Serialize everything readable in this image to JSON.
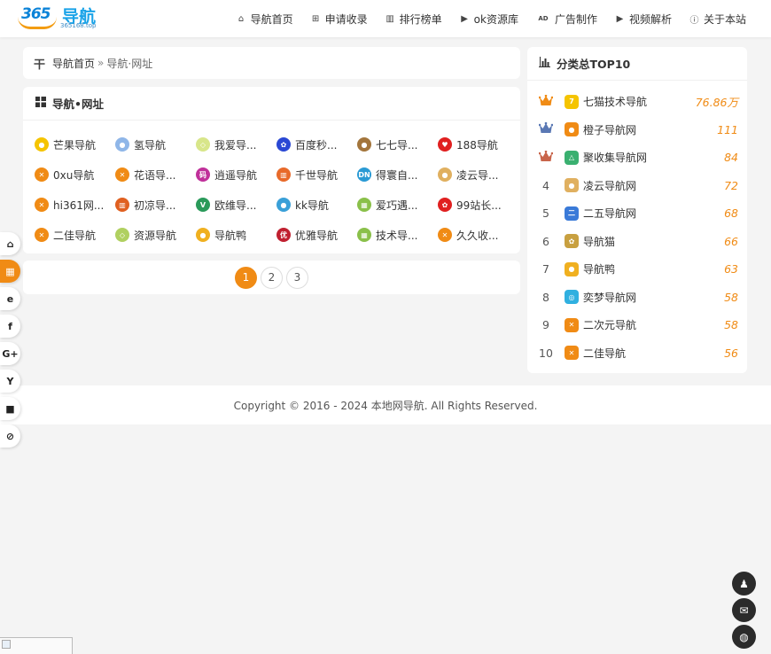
{
  "header": {
    "logo": {
      "main": "365",
      "sub": "导航",
      "domain": "365168.top"
    },
    "nav": [
      {
        "label": "导航首页",
        "icon": "home-icon"
      },
      {
        "label": "申请收录",
        "icon": "plus-square-icon"
      },
      {
        "label": "排行榜单",
        "icon": "bar-chart-icon"
      },
      {
        "label": "ok资源库",
        "icon": "play-square-icon"
      },
      {
        "label": "广告制作",
        "icon": "ad-icon",
        "icon_text": "AD"
      },
      {
        "label": "视频解析",
        "icon": "play-square-icon"
      },
      {
        "label": "关于本站",
        "icon": "info-circle-icon"
      }
    ]
  },
  "breadcrumb": {
    "home": "导航首页",
    "sep": "»",
    "current": "导航·网址"
  },
  "links_panel": {
    "title": "导航•网址",
    "items": [
      {
        "label": "芒果导航",
        "color": "#f5c400",
        "glyph": "●"
      },
      {
        "label": "氢导航",
        "color": "#8fb6e8",
        "glyph": "●"
      },
      {
        "label": "我爱导...",
        "color": "#d8e68a",
        "glyph": "◇"
      },
      {
        "label": "百度秒...",
        "color": "#2a48d4",
        "glyph": "✿"
      },
      {
        "label": "七七导...",
        "color": "#a3753c",
        "glyph": "●"
      },
      {
        "label": "188导航",
        "color": "#e02020",
        "glyph": "♥"
      },
      {
        "label": "0xu导航",
        "color": "#f08b15",
        "glyph": "✕"
      },
      {
        "label": "花语导...",
        "color": "#f08b15",
        "glyph": "✕"
      },
      {
        "label": "逍遥导航",
        "color": "#c0309a",
        "glyph": "码"
      },
      {
        "label": "千世导航",
        "color": "#e86a2a",
        "glyph": "▥"
      },
      {
        "label": "得寰自...",
        "color": "#2a9ad4",
        "glyph": "DN"
      },
      {
        "label": "凌云导...",
        "color": "#e0b060",
        "glyph": "●"
      },
      {
        "label": "hi361网...",
        "color": "#f08b15",
        "glyph": "✕"
      },
      {
        "label": "初凉导...",
        "color": "#e06020",
        "glyph": "▥"
      },
      {
        "label": "欧维导...",
        "color": "#2a9a5a",
        "glyph": "V"
      },
      {
        "label": "kk导航",
        "color": "#3aa0d8",
        "glyph": "●"
      },
      {
        "label": "爱巧遇...",
        "color": "#8ac04a",
        "glyph": "▦"
      },
      {
        "label": "99站长...",
        "color": "#e02020",
        "glyph": "✿"
      },
      {
        "label": "二佳导航",
        "color": "#f08b15",
        "glyph": "✕"
      },
      {
        "label": "资源导航",
        "color": "#b0d060",
        "glyph": "◇"
      },
      {
        "label": "导航鸭",
        "color": "#f0b020",
        "glyph": "●"
      },
      {
        "label": "优雅导航",
        "color": "#c02030",
        "glyph": "优"
      },
      {
        "label": "技术导...",
        "color": "#8ac04a",
        "glyph": "▦"
      },
      {
        "label": "久久收...",
        "color": "#f08b15",
        "glyph": "✕"
      }
    ]
  },
  "pagination": {
    "pages": [
      "1",
      "2",
      "3"
    ],
    "active": "1"
  },
  "top10": {
    "title": "分类总TOP10",
    "items": [
      {
        "rank": "1",
        "name": "七猫技术导航",
        "value": "76.86万",
        "color": "#f5c400",
        "glyph": "7",
        "medal": "#f08b15"
      },
      {
        "rank": "2",
        "name": "橙子导航网",
        "value": "111",
        "color": "#f08b15",
        "glyph": "●",
        "medal": "#5a78b4"
      },
      {
        "rank": "3",
        "name": "聚收集导航网",
        "value": "84",
        "color": "#3ab070",
        "glyph": "△",
        "medal": "#c8644a"
      },
      {
        "rank": "4",
        "name": "凌云导航网",
        "value": "72",
        "color": "#e0b060",
        "glyph": "●"
      },
      {
        "rank": "5",
        "name": "二五导航网",
        "value": "68",
        "color": "#3a7ad8",
        "glyph": "二"
      },
      {
        "rank": "6",
        "name": "导航猫",
        "value": "66",
        "color": "#c8a040",
        "glyph": "✿"
      },
      {
        "rank": "7",
        "name": "导航鸭",
        "value": "63",
        "color": "#f0b020",
        "glyph": "●"
      },
      {
        "rank": "8",
        "name": "奕梦导航网",
        "value": "58",
        "color": "#30b0e0",
        "glyph": "◎"
      },
      {
        "rank": "9",
        "name": "二次元导航",
        "value": "58",
        "color": "#f08b15",
        "glyph": "✕"
      },
      {
        "rank": "10",
        "name": "二佳导航",
        "value": "56",
        "color": "#f08b15",
        "glyph": "✕"
      }
    ]
  },
  "footer": {
    "text": "Copyright © 2016 - 2024 本地网导航. All Rights Reserved."
  },
  "share_bar": [
    {
      "icon": "home-icon",
      "glyph": "⌂"
    },
    {
      "icon": "windows-icon",
      "glyph": "▦",
      "active": true
    },
    {
      "icon": "ie-icon",
      "glyph": "e"
    },
    {
      "icon": "facebook-icon",
      "glyph": "f"
    },
    {
      "icon": "google-plus-icon",
      "glyph": "G+"
    },
    {
      "icon": "y-square-icon",
      "glyph": "Y"
    },
    {
      "icon": "video-camera-icon",
      "glyph": "■"
    },
    {
      "icon": "paperclip-icon",
      "glyph": "⊘"
    }
  ],
  "float_buttons": [
    {
      "icon": "qq-icon",
      "glyph": "♟"
    },
    {
      "icon": "mail-icon",
      "glyph": "✉"
    },
    {
      "icon": "wechat-icon",
      "glyph": "◍"
    }
  ],
  "colors": {
    "accent": "#f08b15",
    "text": "#333333",
    "bg": "#f4f4f4"
  }
}
